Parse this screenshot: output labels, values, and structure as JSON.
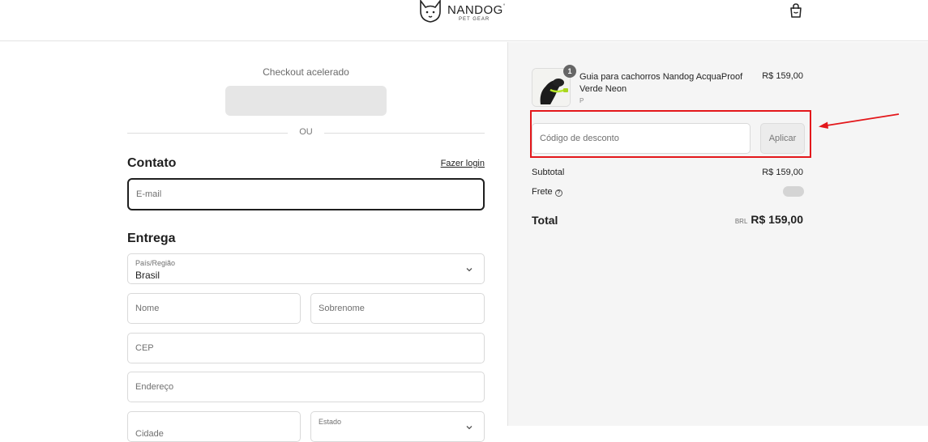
{
  "header": {
    "brand_name": "NANDOG",
    "brand_mark": "°",
    "brand_tagline": "PET GEAR",
    "icons": [
      "dog-logo-icon",
      "shopping-bag-icon"
    ]
  },
  "express": {
    "label": "Checkout acelerado",
    "divider_text": "OU"
  },
  "contact": {
    "title": "Contato",
    "login_link": "Fazer login",
    "email_placeholder": "E-mail"
  },
  "delivery": {
    "title": "Entrega",
    "country_label": "País/Região",
    "country_value": "Brasil",
    "first_name_placeholder": "Nome",
    "last_name_placeholder": "Sobrenome",
    "zip_placeholder": "CEP",
    "address_placeholder": "Endereço",
    "city_placeholder": "Cidade",
    "state_label": "Estado"
  },
  "summary": {
    "item": {
      "quantity": "1",
      "name": "Guia para cachorros Nandog AcquaProof Verde Neon",
      "variant": "P",
      "price": "R$ 159,00"
    },
    "discount_placeholder": "Código de desconto",
    "apply_label": "Aplicar",
    "subtotal_label": "Subtotal",
    "subtotal_value": "R$ 159,00",
    "shipping_label": "Frete",
    "total_label": "Total",
    "total_currency": "BRL",
    "total_value": "R$ 159,00"
  },
  "colors": {
    "annotation_red": "#e3171b",
    "summary_bg": "#f5f5f5",
    "text": "#1f1f1f"
  }
}
